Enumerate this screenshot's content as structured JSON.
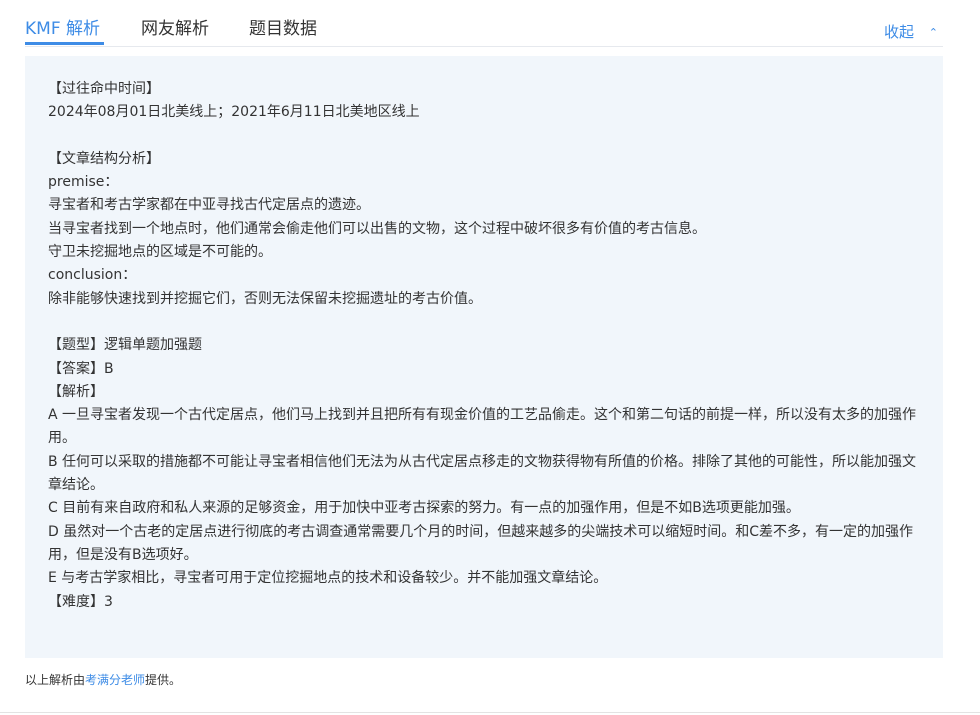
{
  "tabs": [
    {
      "label": "KMF 解析",
      "active": true
    },
    {
      "label": "网友解析",
      "active": false
    },
    {
      "label": "题目数据",
      "active": false
    }
  ],
  "collapse_label": "收起",
  "analysis": {
    "past_hits_header": "【过往命中时间】",
    "past_hits": "2024年08月01日北美线上；2021年6月11日北美地区线上",
    "structure_header": "【文章结构分析】",
    "premise_label": "premise：",
    "premise_lines": [
      "寻宝者和考古学家都在中亚寻找古代定居点的遗迹。",
      "当寻宝者找到一个地点时，他们通常会偷走他们可以出售的文物，这个过程中破坏很多有价值的考古信息。",
      "守卫未挖掘地点的区域是不可能的。"
    ],
    "conclusion_label": "conclusion：",
    "conclusion_line": "除非能够快速找到并挖掘它们，否则无法保留未挖掘遗址的考古价值。",
    "question_type": "【题型】逻辑单题加强题",
    "answer": "【答案】B",
    "explanation_header": "【解析】",
    "options": [
      "A 一旦寻宝者发现一个古代定居点，他们马上找到并且把所有有现金价值的工艺品偷走。这个和第二句话的前提一样，所以没有太多的加强作用。",
      "B 任何可以采取的措施都不可能让寻宝者相信他们无法为从古代定居点移走的文物获得物有所值的价格。排除了其他的可能性，所以能加强文章结论。",
      "C 目前有来自政府和私人来源的足够资金，用于加快中亚考古探索的努力。有一点的加强作用，但是不如B选项更能加强。",
      "D 虽然对一个古老的定居点进行彻底的考古调查通常需要几个月的时间，但越来越多的尖端技术可以缩短时间。和C差不多，有一定的加强作用，但是没有B选项好。",
      "E 与考古学家相比，寻宝者可用于定位挖掘地点的技术和设备较少。并不能加强文章结论。"
    ],
    "difficulty": "【难度】3"
  },
  "footer": {
    "prefix": "以上解析由",
    "link": "考满分老师",
    "suffix": "提供。"
  },
  "colors": {
    "accent": "#3e8ce6",
    "panel_bg": "#f1f6fb"
  }
}
